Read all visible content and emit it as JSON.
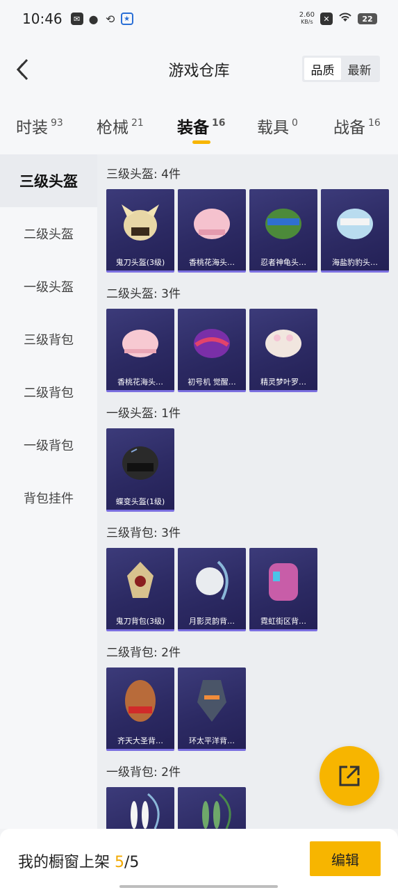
{
  "status": {
    "time": "10:46",
    "speed_value": "2.60",
    "speed_unit": "KB/s",
    "battery": "22"
  },
  "header": {
    "title": "游戏仓库",
    "sort_quality": "品质",
    "sort_newest": "最新"
  },
  "tabs": [
    {
      "label": "时装",
      "count": "93"
    },
    {
      "label": "枪械",
      "count": "21"
    },
    {
      "label": "装备",
      "count": "16"
    },
    {
      "label": "载具",
      "count": "0"
    },
    {
      "label": "战备",
      "count": "16"
    }
  ],
  "sidebar": [
    {
      "label": "三级头盔"
    },
    {
      "label": "二级头盔"
    },
    {
      "label": "一级头盔"
    },
    {
      "label": "三级背包"
    },
    {
      "label": "二级背包"
    },
    {
      "label": "一级背包"
    },
    {
      "label": "背包挂件"
    }
  ],
  "sections": [
    {
      "title": "三级头盔: 4件",
      "items": [
        {
          "name": "鬼刀头盔(3级)",
          "icon": "golden-dragon-helmet-icon"
        },
        {
          "name": "香桃花海头…",
          "icon": "pink-helmet-icon"
        },
        {
          "name": "忍者神龟头…",
          "icon": "ninja-turtle-helmet-icon"
        },
        {
          "name": "海盐豹豹头…",
          "icon": "blue-goggle-helmet-icon"
        }
      ]
    },
    {
      "title": "二级头盔: 3件",
      "items": [
        {
          "name": "香桃花海头…",
          "icon": "pink-helmet-icon"
        },
        {
          "name": "初号机 觉醒…",
          "icon": "purple-helmet-icon"
        },
        {
          "name": "精灵梦叶罗…",
          "icon": "elf-helmet-icon"
        }
      ]
    },
    {
      "title": "一级头盔: 1件",
      "items": [
        {
          "name": "蝶变头盔(1级)",
          "icon": "black-helmet-icon"
        }
      ]
    },
    {
      "title": "三级背包: 3件",
      "items": [
        {
          "name": "鬼刀背包(3级)",
          "icon": "golden-backpack-icon"
        },
        {
          "name": "月影灵韵背…",
          "icon": "moon-backpack-icon"
        },
        {
          "name": "霓虹街区背…",
          "icon": "neon-backpack-icon"
        }
      ]
    },
    {
      "title": "二级背包: 2件",
      "items": [
        {
          "name": "齐天大圣背…",
          "icon": "monkey-king-backpack-icon"
        },
        {
          "name": "环太平洋背…",
          "icon": "mech-backpack-icon"
        }
      ]
    },
    {
      "title": "一级背包: 2件",
      "items": [
        {
          "name": "",
          "icon": "bunny-backpack-icon"
        },
        {
          "name": "",
          "icon": "green-bunny-backpack-icon"
        }
      ]
    }
  ],
  "footer": {
    "label": "我的橱窗上架",
    "count_current": "5",
    "count_total": "/5",
    "edit_label": "编辑"
  },
  "colors": {
    "accent": "#f7b500",
    "card_bg": "#2c2a63",
    "card_border": "#7b6fe0"
  }
}
